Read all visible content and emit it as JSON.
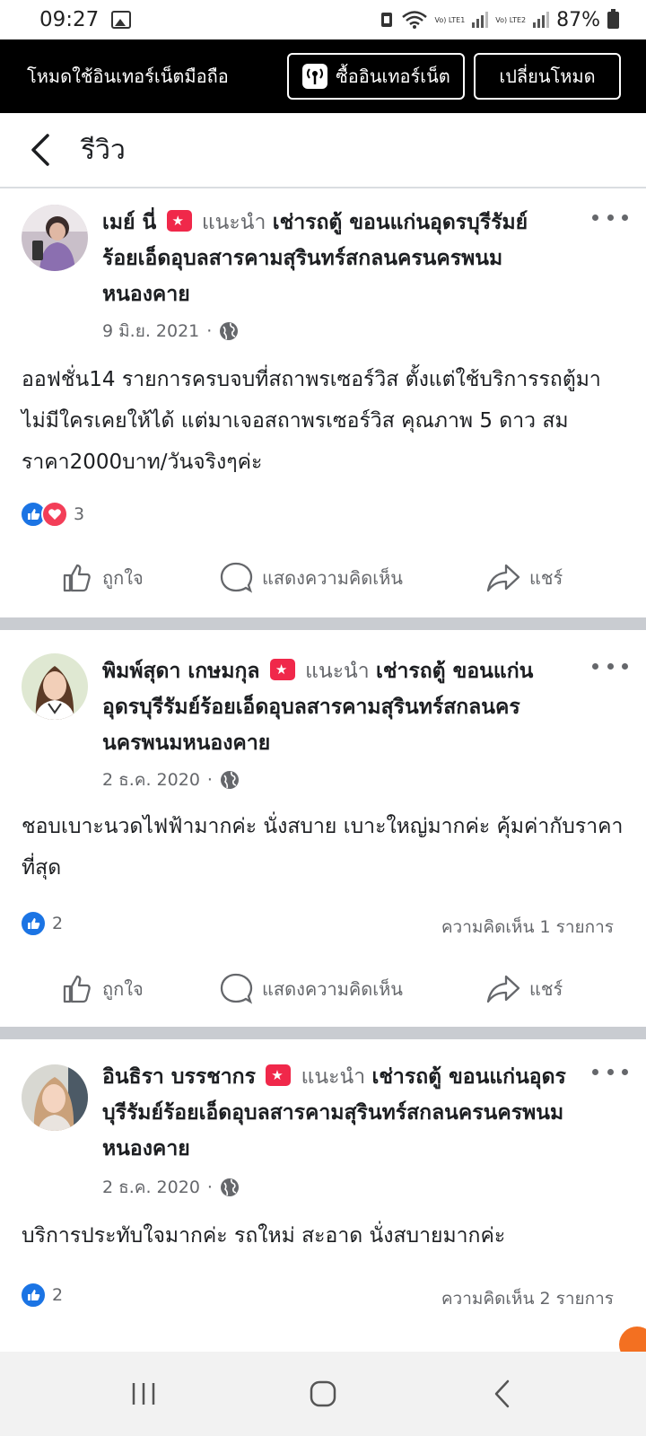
{
  "status_bar": {
    "time": "09:27",
    "sim1_label": "Vo) LTE1",
    "sim2_label": "Vo) LTE2",
    "battery": "87%"
  },
  "data_banner": {
    "text": "โหมดใช้อินเทอร์เน็ตมือถือ",
    "buy_label": "ซื้ออินเทอร์เน็ต",
    "switch_label": "เปลี่ยนโหมด"
  },
  "header": {
    "title": "รีวิว"
  },
  "posts": [
    {
      "author": "เมย์ นี่",
      "recommends": "แนะนำ",
      "page": "เช่ารถตู้ ขอนแก่นอุดรบุรีรัมย์ร้อยเอ็ดอุบลสารคามสุรินทร์สกลนครนครพนมหนองคาย",
      "date": "9 มิ.ย. 2021",
      "body": "ออฟชั่น14 รายการครบจบที่สถาพรเซอร์วิส ตั้งแต่ใช้บริการรถตู้มา ไม่มีใครเคยให้ได้ แต่มาเจอสถาพรเซอร์วิส คุณภาพ 5 ดาว สมราคา2000บาท/วันจริงๆค่ะ",
      "reaction_count": "3",
      "comment_count": ""
    },
    {
      "author": "พิมพ์สุดา เกษมกุล",
      "recommends": "แนะนำ",
      "page": "เช่ารถตู้ ขอนแก่นอุดรบุรีรัมย์ร้อยเอ็ดอุบลสารคามสุรินทร์สกลนครนครพนมหนองคาย",
      "date": "2 ธ.ค. 2020",
      "body": "ชอบเบาะนวดไฟฟ้ามากค่ะ นั่งสบาย เบาะใหญ่มากค่ะ คุ้มค่ากับราคาที่สุด",
      "reaction_count": "2",
      "comment_count": "ความคิดเห็น 1 รายการ"
    },
    {
      "author": "อินธิรา บรรชากร",
      "recommends": "แนะนำ",
      "page": "เช่ารถตู้ ขอนแก่นอุดรบุรีรัมย์ร้อยเอ็ดอุบลสารคามสุรินทร์สกลนครนครพนมหนองคาย",
      "date": "2 ธ.ค. 2020",
      "body": "บริการประทับใจมากค่ะ รถใหม่ สะอาด นั่งสบายมากค่ะ",
      "reaction_count": "2",
      "comment_count": "ความคิดเห็น 2 รายการ"
    }
  ],
  "actions": {
    "like": "ถูกใจ",
    "comment": "แสดงความคิดเห็น",
    "share": "แชร์"
  },
  "colors": {
    "like_blue": "#1b74e4",
    "love_red": "#f33e58",
    "recommend_red": "#f0284a",
    "secondary_text": "#65676b"
  }
}
